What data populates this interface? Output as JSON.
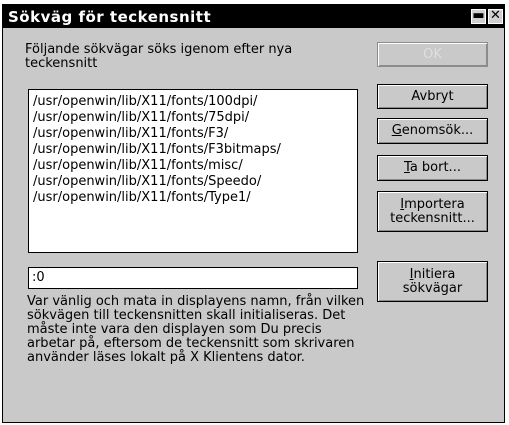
{
  "window": {
    "title": "Sökväg för teckensnitt",
    "min_glyph": "▬",
    "close_glyph": "✕"
  },
  "description": "Följande sökvägar söks igenom efter nya teckensnitt",
  "paths": [
    "/usr/openwin/lib/X11/fonts/100dpi/",
    "/usr/openwin/lib/X11/fonts/75dpi/",
    "/usr/openwin/lib/X11/fonts/F3/",
    "/usr/openwin/lib/X11/fonts/F3bitmaps/",
    "/usr/openwin/lib/X11/fonts/misc/",
    "/usr/openwin/lib/X11/fonts/Speedo/",
    "/usr/openwin/lib/X11/fonts/Type1/"
  ],
  "display_input": {
    "value": ":0"
  },
  "note": "Var vänlig och mata in displayens namn, från vilken sökvägen till teckensnitten skall initialiseras. Det måste inte vara den displayen som Du precis arbetar på, eftersom de teckensnitt som skrivaren använder läses lokalt på X Klientens dator.",
  "buttons": {
    "ok": "OK",
    "cancel": "Avbryt",
    "browse_mn": "G",
    "browse_rest": "enomsök...",
    "remove_mn": "T",
    "remove_rest": "a bort...",
    "import_mn": "I",
    "import_rest": "mportera",
    "import_line2": "teckensnitt...",
    "init_mn": "I",
    "init_rest": "nitiera",
    "init_line2": "sökvägar"
  }
}
